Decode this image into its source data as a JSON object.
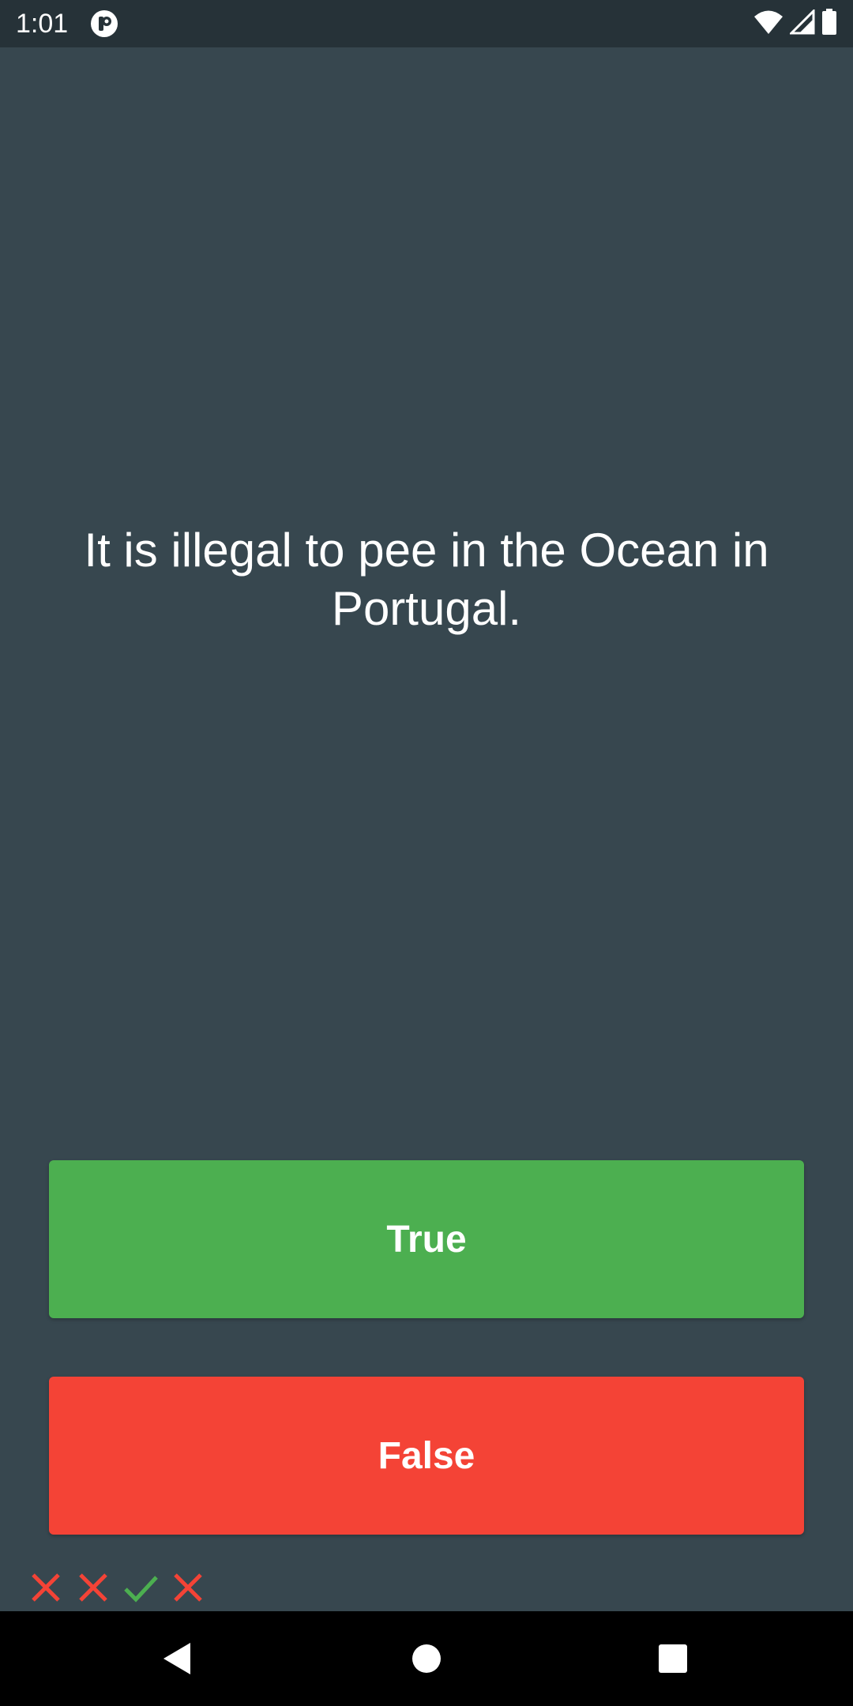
{
  "status_bar": {
    "time": "1:01",
    "app_indicator_icon": "app-indicator-icon",
    "wifi_icon": "wifi-icon",
    "signal_icon": "cell-signal-icon",
    "battery_icon": "battery-icon"
  },
  "quiz": {
    "question": "It is illegal to pee in the Ocean in Portugal.",
    "true_label": "True",
    "false_label": "False",
    "score_keeper": [
      {
        "result": "wrong",
        "icon": "cross-icon"
      },
      {
        "result": "wrong",
        "icon": "cross-icon"
      },
      {
        "result": "correct",
        "icon": "check-icon"
      },
      {
        "result": "wrong",
        "icon": "cross-icon"
      }
    ]
  },
  "colors": {
    "background": "#37474f",
    "status_bar": "#263238",
    "true_button": "#4caf50",
    "false_button": "#f44336",
    "correct_mark": "#4caf50",
    "wrong_mark": "#f44336"
  },
  "nav_bar": {
    "back_icon": "back-icon",
    "home_icon": "home-icon",
    "recents_icon": "recents-icon"
  }
}
